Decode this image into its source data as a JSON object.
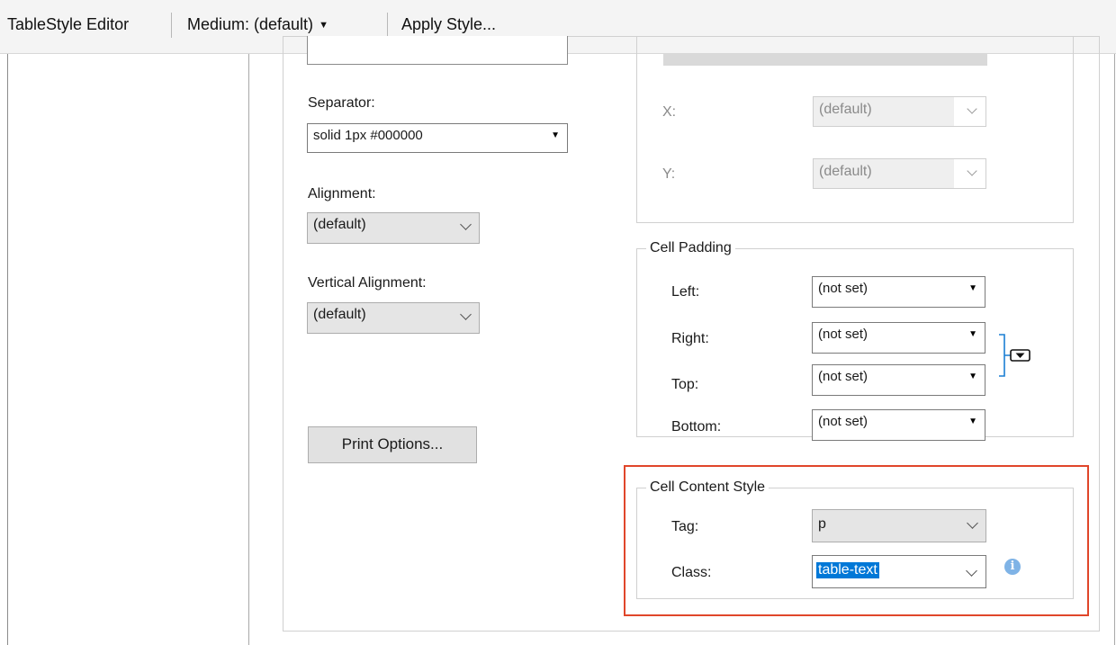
{
  "toolbar": {
    "title": "TableStyle Editor",
    "medium_label": "Medium: (default)",
    "apply_style_label": "Apply Style..."
  },
  "left": {
    "separator_label": "Separator:",
    "separator_value": "solid 1px #000000",
    "alignment_label": "Alignment:",
    "alignment_value": "(default)",
    "vertical_alignment_label": "Vertical Alignment:",
    "vertical_alignment_value": "(default)",
    "print_options_label": "Print Options..."
  },
  "position": {
    "x_label": "X:",
    "x_value": "(default)",
    "y_label": "Y:",
    "y_value": "(default)"
  },
  "cell_padding": {
    "legend": "Cell Padding",
    "left_label": "Left:",
    "left_value": "(not set)",
    "right_label": "Right:",
    "right_value": "(not set)",
    "top_label": "Top:",
    "top_value": "(not set)",
    "bottom_label": "Bottom:",
    "bottom_value": "(not set)"
  },
  "cell_content_style": {
    "legend": "Cell Content Style",
    "tag_label": "Tag:",
    "tag_value": "p",
    "class_label": "Class:",
    "class_value": "table-text"
  },
  "icons": {
    "link_padding": "bracket-dropdown-icon",
    "info": "info-icon"
  },
  "colors": {
    "highlight": "#e0462a",
    "selection": "#0078d7",
    "link_icon": "#1a7fd4",
    "info_icon": "#7fb3e6"
  }
}
